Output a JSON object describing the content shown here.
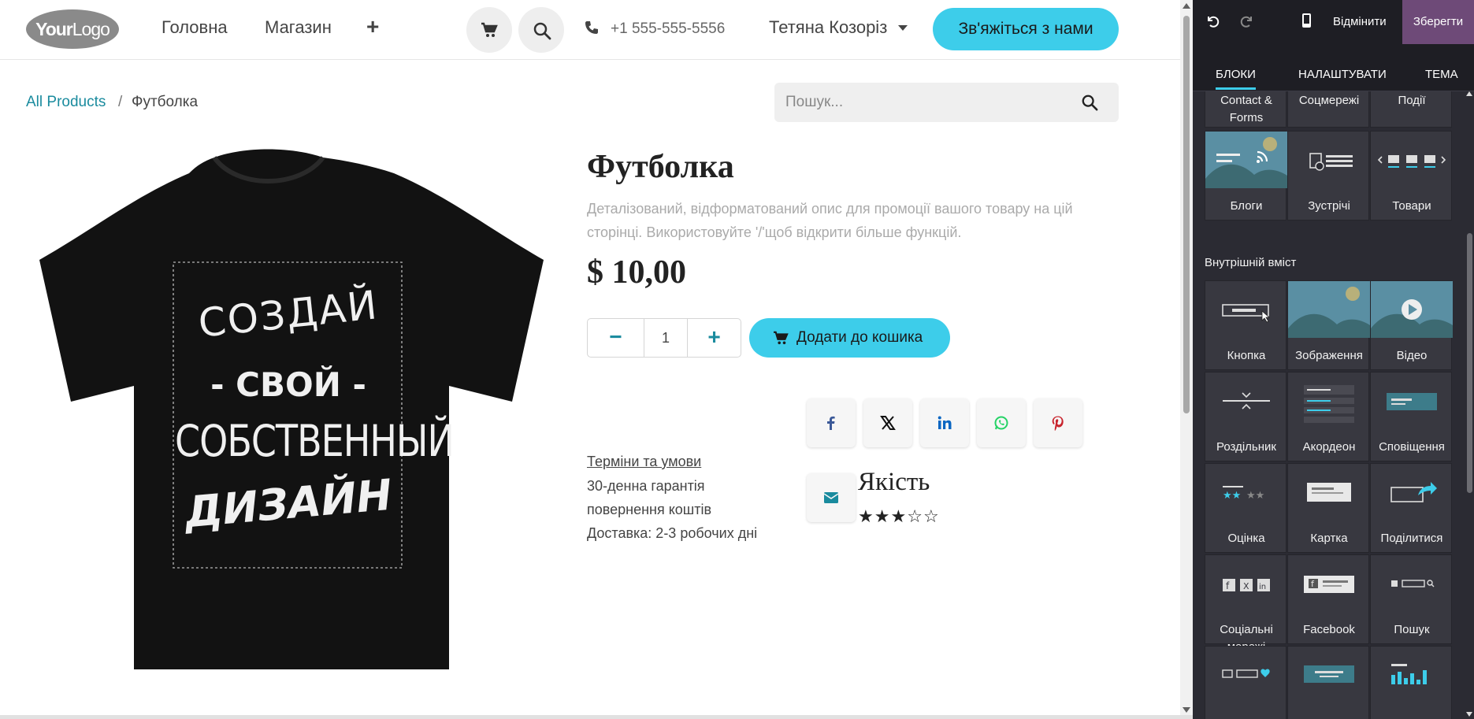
{
  "header": {
    "logo_main": "Your",
    "logo_sub": "Logo",
    "nav": [
      "Головна",
      "Магазин"
    ],
    "phone": "+1 555-555-5556",
    "user_name": "Тетяна Козоріз",
    "cta_label": "Зв'яжіться з нами"
  },
  "breadcrumb": {
    "link": "All Products",
    "separator": "/",
    "current": "Футболка"
  },
  "search": {
    "placeholder": "Пошук..."
  },
  "shirt_print": {
    "line1": "СОЗДАЙ",
    "line2": "- СВОЙ -",
    "line3": "СОБСТВЕННЫЙ",
    "line4": "ДИЗАЙН"
  },
  "product": {
    "title": "Футболка",
    "description": "Деталізований, відформатований опис для промоції вашого товару на цій сторінці. Використовуйте '/'щоб відкрити більше функцій.",
    "price": "$ 10,00",
    "quantity": "1",
    "add_to_cart": "Додати до кошика",
    "terms": "Терміни та умови",
    "guarantee_line1": "30-денна гарантія",
    "guarantee_line2": "повернення коштів",
    "delivery": "Доставка: 2-3 робочих дні",
    "quality_label": "Якість",
    "rating": 3,
    "rating_max": 5
  },
  "share": {
    "icons": [
      "facebook-icon",
      "x-icon",
      "linkedin-icon",
      "whatsapp-icon",
      "pinterest-icon",
      "email-icon"
    ],
    "colors": {
      "facebook": "#3b5998",
      "x": "#111111",
      "linkedin": "#0a66c2",
      "whatsapp": "#25d366",
      "pinterest": "#c8232c",
      "email": "#1a8b9e"
    }
  },
  "editor": {
    "discard": "Відмінити",
    "save": "Зберегти",
    "tabs": [
      "БЛОКИ",
      "НАЛАШТУВАТИ",
      "ТЕМА"
    ],
    "active_tab": "БЛОКИ",
    "top_row": [
      "Contact & Forms",
      "Соцмережі",
      "Події"
    ],
    "row2": [
      "Блоги",
      "Зустрічі",
      "Товари"
    ],
    "section_inner": "Внутрішній вміст",
    "inner_rows": [
      [
        "Кнопка",
        "Зображення",
        "Відео"
      ],
      [
        "Роздільник",
        "Акордеон",
        "Сповіщення"
      ],
      [
        "Оцінка",
        "Картка",
        "Поділитися"
      ],
      [
        "Соціальні мережі",
        "Facebook",
        "Пошук"
      ]
    ]
  },
  "colors": {
    "accent": "#3dcdea",
    "link": "#1a8b9e",
    "save": "#6e4a78",
    "panel": "#2b2b33"
  }
}
